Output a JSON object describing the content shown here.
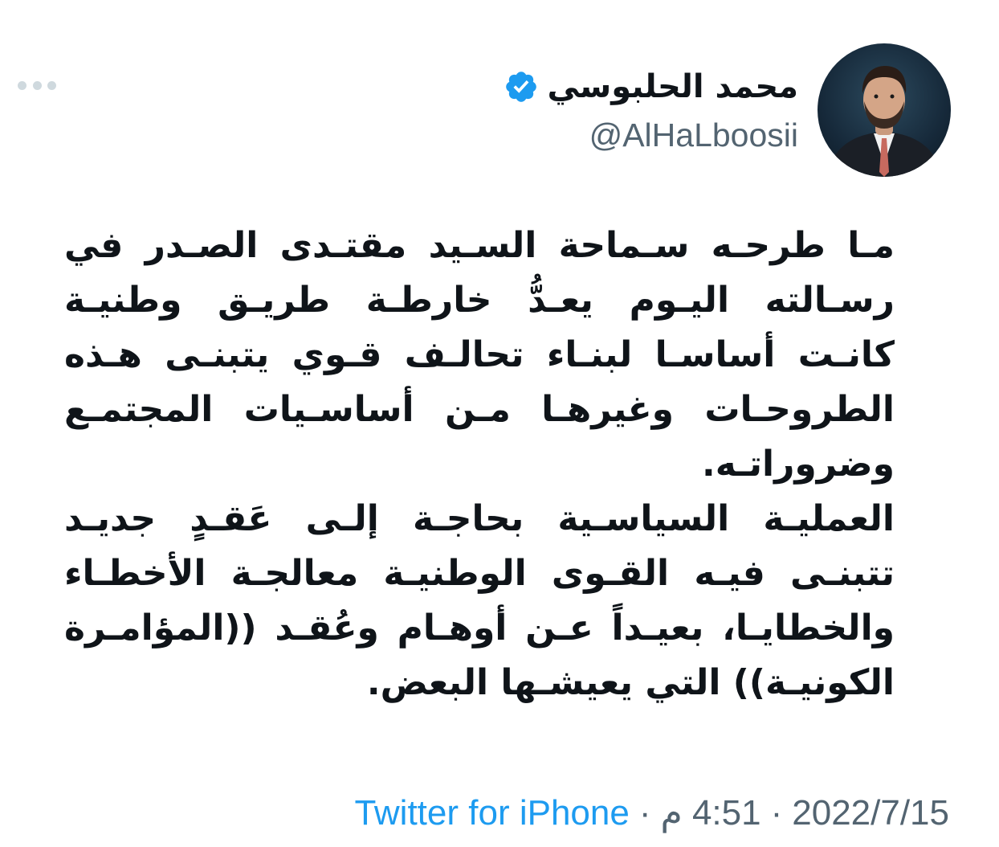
{
  "user": {
    "display_name": "محمد الحلبوسي",
    "handle": "@AlHaLboosii",
    "verified": true,
    "avatar_icon": "person-portrait"
  },
  "tweet": {
    "lines": [
      "مـا طرحـه سـماحة السـيد مقتـدى الصـدر في",
      "رسـالته اليـوم يعـدُّ خارطـة طريـق وطنيـة",
      "كانـت أساسـا لبنـاء تحالـف قـوي يتبنـى هـذه",
      "الطروحـات وغيرهـا مـن أساسـيات المجتمـع",
      "وضروراتـه.",
      "العمليـة السياسـية بحاجـة إلـى عَقـدٍ جديـد",
      "تتبنـى فيـه القـوى الوطنيـة معالجـة الأخطـاء",
      "والخطايـا، بعيـداً عـن أوهـام وعُقـد ((المؤامـرة",
      "الكونيـة)) التي يعيشـها البعض."
    ]
  },
  "meta": {
    "source": "Twitter for iPhone",
    "separator": "·",
    "time": "4:51 م",
    "date": "2022/7/15"
  },
  "colors": {
    "verified_badge": "#1d9bf0",
    "source_link": "#1d9bf0",
    "secondary_text": "#536471",
    "primary_text": "#0f1419"
  },
  "icons": {
    "more": "more-horizontal-icon",
    "verified": "verified-badge-icon"
  }
}
